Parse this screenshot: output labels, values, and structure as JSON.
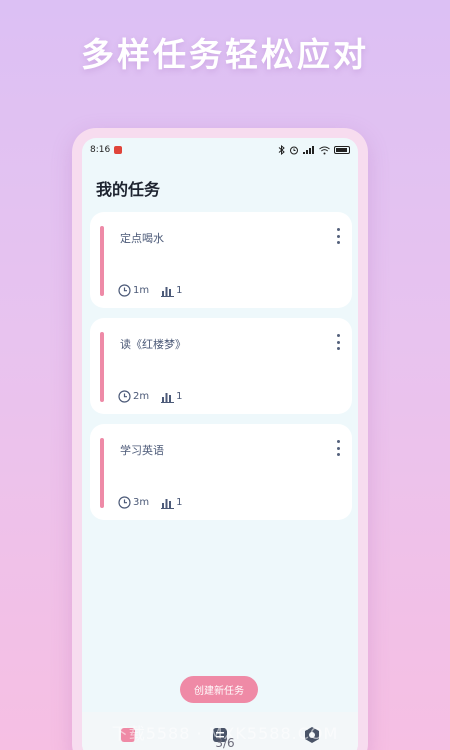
{
  "headline": "多样任务轻松应对",
  "status_bar": {
    "time": "8:16"
  },
  "page_title": "我的任务",
  "tasks": [
    {
      "name": "定点喝水",
      "duration": "1m",
      "count": "1"
    },
    {
      "name": "读《红楼梦》",
      "duration": "2m",
      "count": "1"
    },
    {
      "name": "学习英语",
      "duration": "3m",
      "count": "1"
    }
  ],
  "create_button": "创建新任务",
  "pager": "3/6",
  "watermark": "下载5588 · MXK5588.COM",
  "colors": {
    "accent": "#ee8aa7",
    "card": "#ffffff",
    "screen_bg": "#eef8fb"
  },
  "icons": [
    "bluetooth-icon",
    "alarm-icon",
    "signal-icon",
    "wifi-icon",
    "battery-icon",
    "clock-icon",
    "bar-chart-icon",
    "more-vertical-icon",
    "home-icon",
    "list-icon",
    "settings-icon"
  ]
}
